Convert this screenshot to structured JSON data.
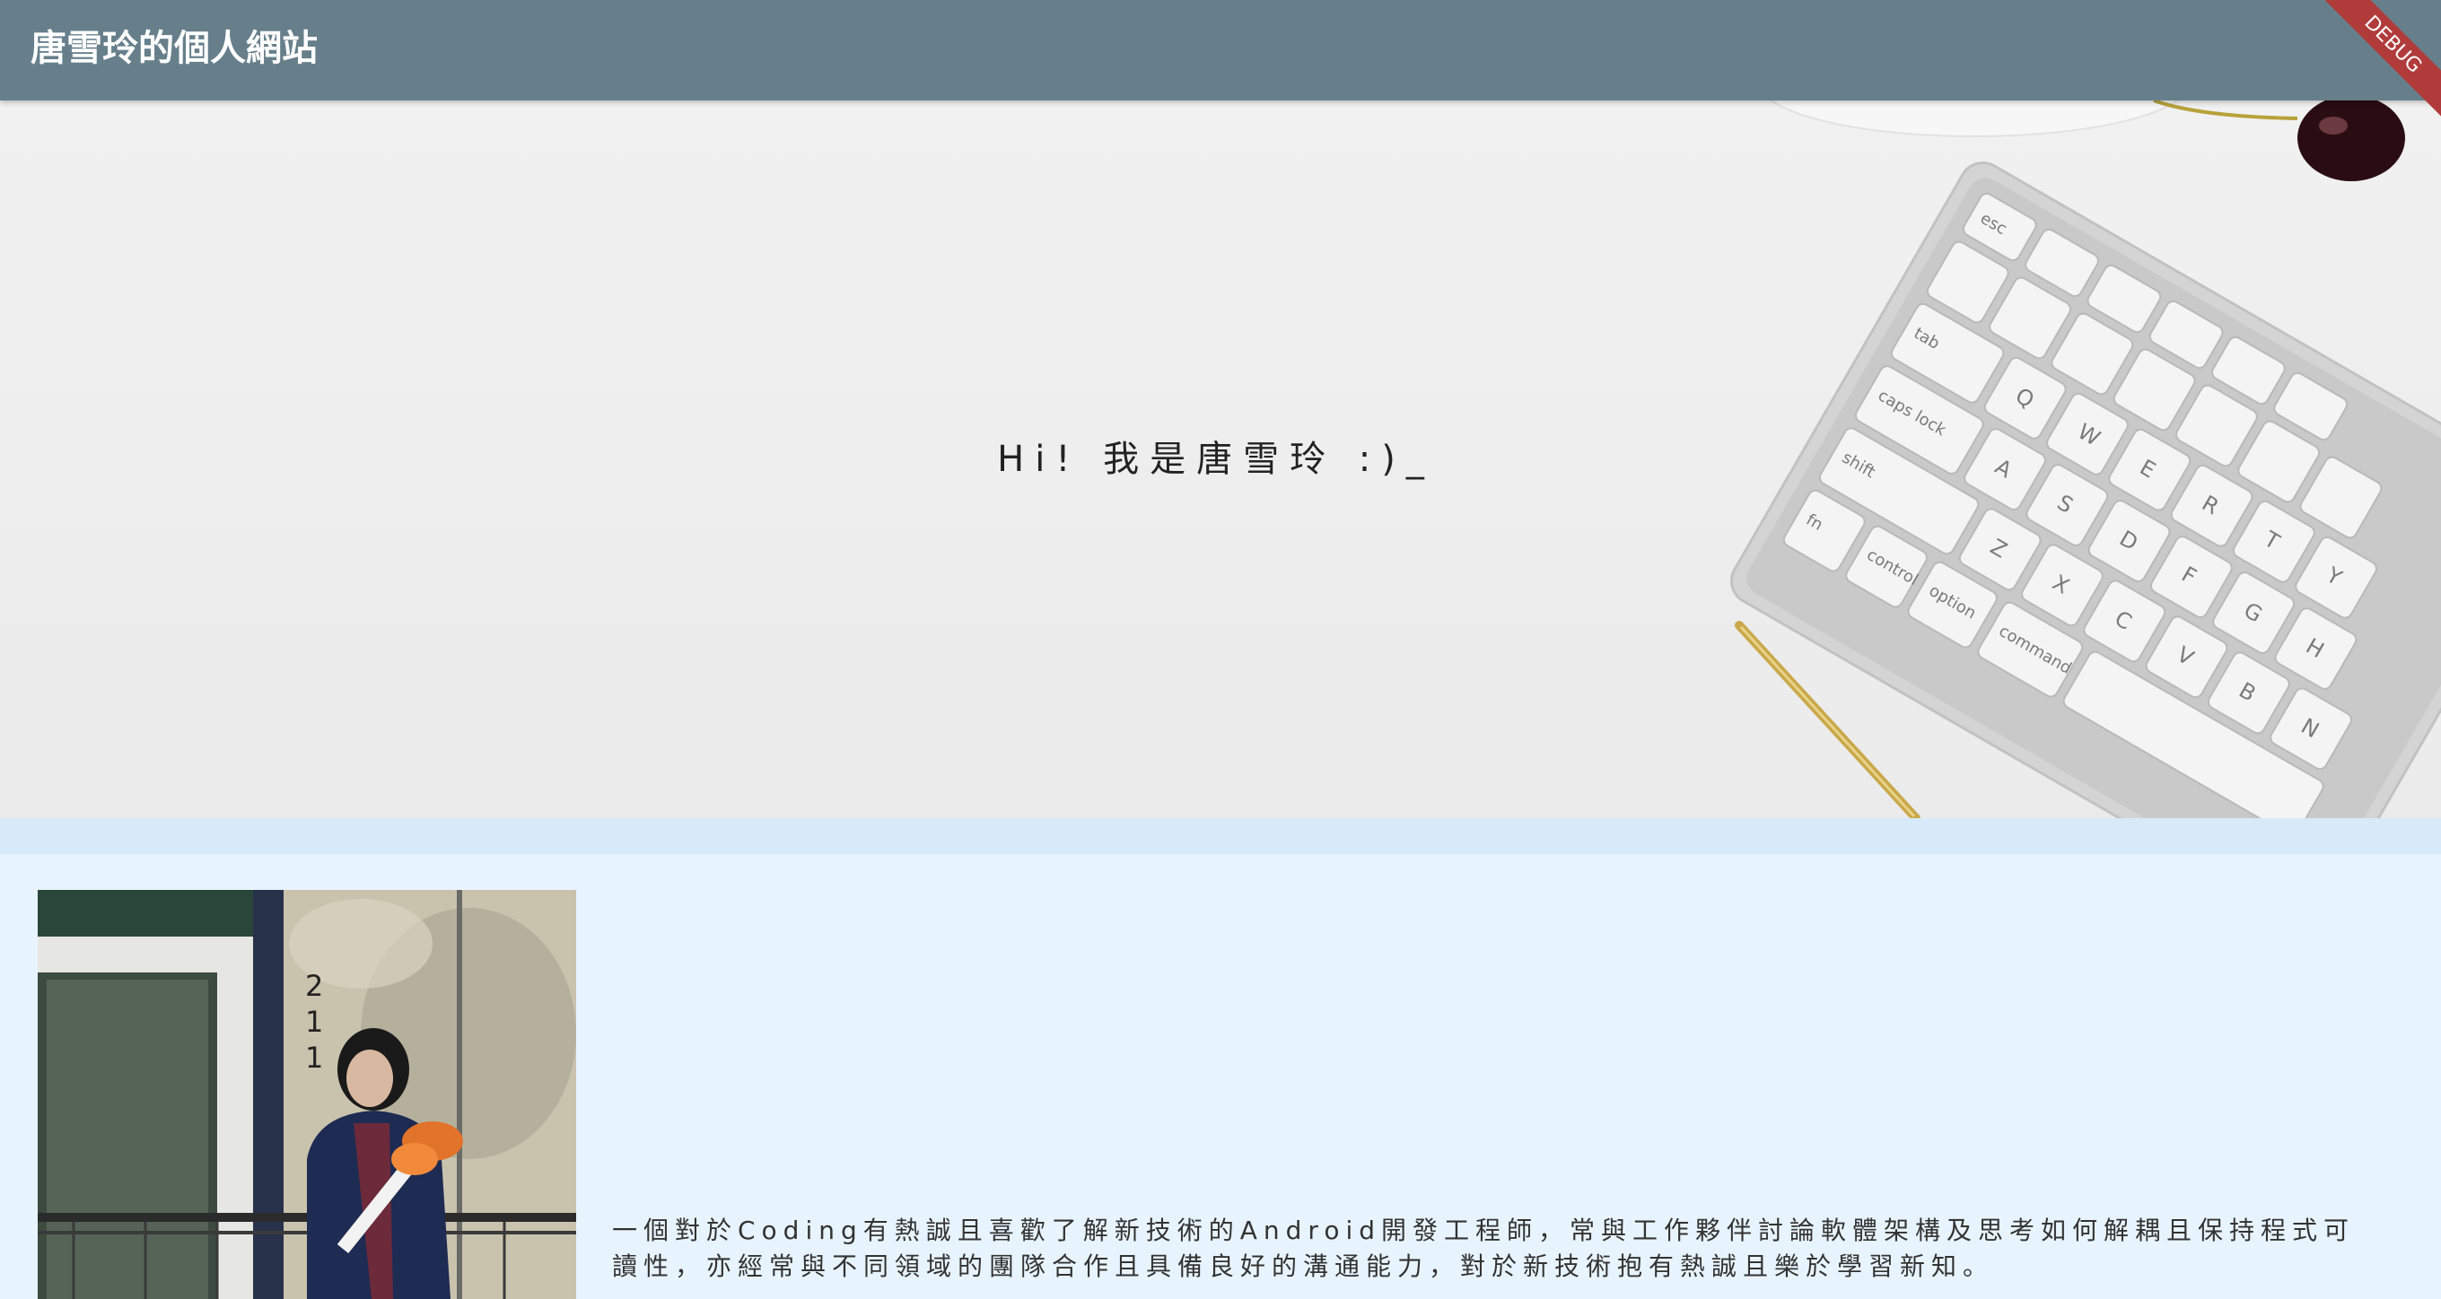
{
  "app_bar": {
    "title": "唐雪玲的個人網站",
    "color": "#667f8b"
  },
  "debug_banner": {
    "label": "DEBUG",
    "color": "#b13b3b"
  },
  "hero": {
    "greeting": "Hi! 我是唐雪玲 :)_",
    "background_image": "desk-keyboard-pen-photo"
  },
  "about": {
    "photo": "profile-photo",
    "description": "一個對於Coding有熱誠且喜歡了解新技術的Android開發工程師，常與工作夥伴討論軟體架構及思考如何解耦且保持程式可讀性，亦經常與不同領域的團隊合作且具備良好的溝通能力，對於新技術抱有熱誠且樂於學習新知。",
    "background_color": "#e8f4fd"
  }
}
